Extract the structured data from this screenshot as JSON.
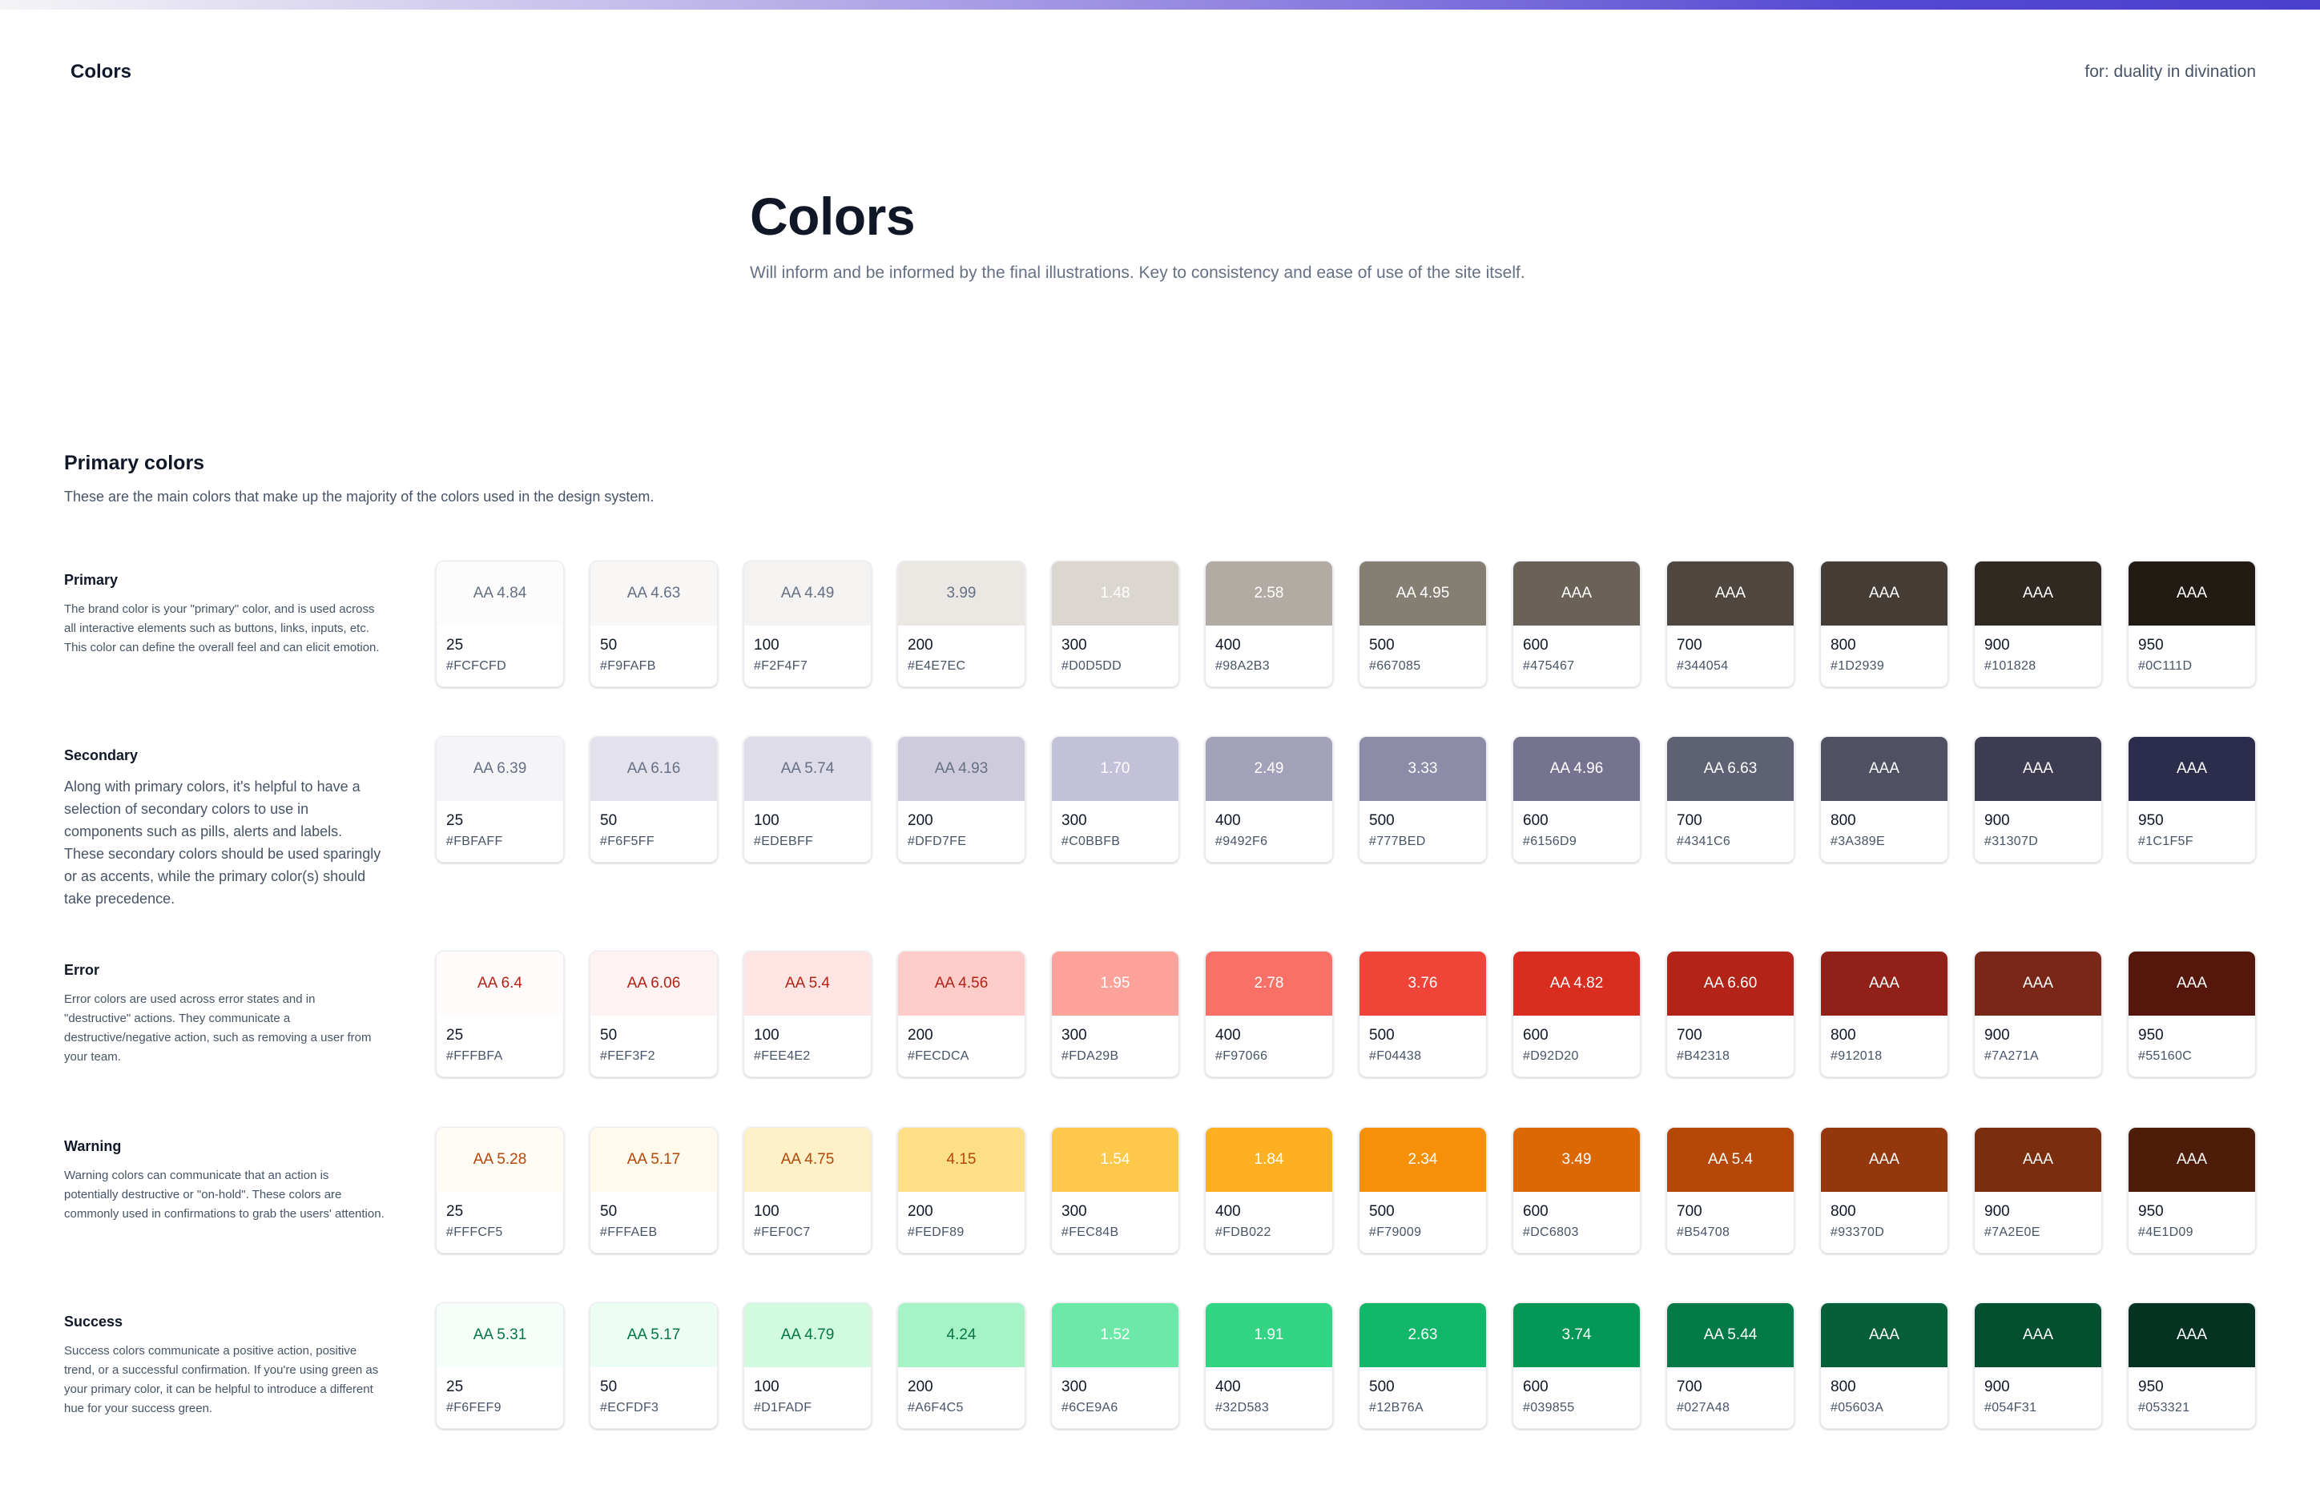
{
  "header": {
    "brand": "Colors",
    "for_label": "for: duality in divination"
  },
  "hero": {
    "title": "Colors",
    "subtitle": "Will inform and be informed by the final illustrations. Key to consistency and ease of use of the site itself."
  },
  "section": {
    "title": "Primary colors",
    "subtitle": "These are the main colors that make up the majority of the colors used in the design system."
  },
  "steps": [
    "25",
    "50",
    "100",
    "200",
    "300",
    "400",
    "500",
    "600",
    "700",
    "800",
    "900",
    "950"
  ],
  "groups": [
    {
      "name": "Primary",
      "description": "The brand color is your \"primary\" color, and is used across all interactive elements such as buttons, links, inputs, etc. This color can define the overall feel and can elicit emotion.",
      "text_colors": [
        "#667085",
        "#667085",
        "#667085",
        "#667085",
        "#ffffff",
        "#ffffff",
        "#ffffff",
        "#ffffff",
        "#ffffff",
        "#ffffff",
        "#ffffff",
        "#ffffff"
      ],
      "contrast": [
        "AA 4.84",
        "AA 4.63",
        "AA 4.49",
        "3.99",
        "1.48",
        "2.58",
        "AA 4.95",
        "AAA",
        "AAA",
        "AAA",
        "AAA",
        "AAA"
      ],
      "hex": [
        "#FCFCFD",
        "#F9FAFB",
        "#F2F4F7",
        "#E4E7EC",
        "#D0D5DD",
        "#98A2B3",
        "#667085",
        "#475467",
        "#344054",
        "#1D2939",
        "#101828",
        "#0C111D"
      ],
      "swatch_colors": [
        "#FCFCFD",
        "#F8F7F6",
        "#F5F3F1",
        "#EBE7E3",
        "#DCD6D1",
        "#B2ABA4",
        "#857E72",
        "#6A6159",
        "#4E463F",
        "#443C35",
        "#2F2922",
        "#221B14"
      ]
    },
    {
      "name": "Secondary",
      "description": "Along with primary colors, it's helpful to have a selection of secondary colors to use in components such as pills, alerts and labels. These secondary colors should be used sparingly or as accents, while the primary color(s) should take precedence.",
      "text_colors": [
        "#667085",
        "#667085",
        "#667085",
        "#667085",
        "#ffffff",
        "#ffffff",
        "#ffffff",
        "#ffffff",
        "#ffffff",
        "#ffffff",
        "#ffffff",
        "#ffffff"
      ],
      "contrast": [
        "AA 6.39",
        "AA 6.16",
        "AA 5.74",
        "AA 4.93",
        "1.70",
        "2.49",
        "3.33",
        "AA 4.96",
        "AA 6.63",
        "AAA",
        "AAA",
        "AAA"
      ],
      "hex": [
        "#FBFAFF",
        "#F6F5FF",
        "#EDEBFF",
        "#DFD7FE",
        "#C0BBFB",
        "#9492F6",
        "#777BED",
        "#6156D9",
        "#4341C6",
        "#3A389E",
        "#31307D",
        "#1C1F5F"
      ],
      "swatch_colors": [
        "#F5F5F7",
        "#E3E1EC",
        "#DEDCE8",
        "#CECBDC",
        "#C3C0DA",
        "#A3A1B9",
        "#8C8BA8",
        "#75738F",
        "#5E6174",
        "#4F5163",
        "#3D3C52",
        "#2C2C4C"
      ]
    },
    {
      "name": "Error",
      "description": "Error colors are used across error states and in \"destructive\" actions. They communicate a destructive/negative action, such as removing a user from your team.",
      "text_colors": [
        "#B42318",
        "#B42318",
        "#B42318",
        "#B42318",
        "#ffffff",
        "#ffffff",
        "#ffffff",
        "#ffffff",
        "#ffffff",
        "#ffffff",
        "#ffffff",
        "#ffffff"
      ],
      "contrast": [
        "AA 6.4",
        "AA 6.06",
        "AA 5.4",
        "AA 4.56",
        "1.95",
        "2.78",
        "3.76",
        "AA 4.82",
        "AA 6.60",
        "AAA",
        "AAA",
        "AAA"
      ],
      "hex": [
        "#FFFBFA",
        "#FEF3F2",
        "#FEE4E2",
        "#FECDCA",
        "#FDA29B",
        "#F97066",
        "#F04438",
        "#D92D20",
        "#B42318",
        "#912018",
        "#7A271A",
        "#55160C"
      ],
      "swatch_colors": [
        "#FFFBFA",
        "#FEF3F2",
        "#FEE4E2",
        "#FECDCA",
        "#FDA29B",
        "#F97066",
        "#F04438",
        "#D92D20",
        "#B42318",
        "#912018",
        "#7A271A",
        "#55160C"
      ]
    },
    {
      "name": "Warning",
      "description": "Warning colors can communicate that an action is potentially destructive or \"on-hold\". These colors are commonly used in confirmations to grab the users' attention.",
      "text_colors": [
        "#B54708",
        "#B54708",
        "#B54708",
        "#B54708",
        "#ffffff",
        "#ffffff",
        "#ffffff",
        "#ffffff",
        "#ffffff",
        "#ffffff",
        "#ffffff",
        "#ffffff"
      ],
      "contrast": [
        "AA 5.28",
        "AA 5.17",
        "AA 4.75",
        "4.15",
        "1.54",
        "1.84",
        "2.34",
        "3.49",
        "AA 5.4",
        "AAA",
        "AAA",
        "AAA"
      ],
      "hex": [
        "#FFFCF5",
        "#FFFAEB",
        "#FEF0C7",
        "#FEDF89",
        "#FEC84B",
        "#FDB022",
        "#F79009",
        "#DC6803",
        "#B54708",
        "#93370D",
        "#7A2E0E",
        "#4E1D09"
      ],
      "swatch_colors": [
        "#FFFCF5",
        "#FFFAEB",
        "#FEF0C7",
        "#FEDF89",
        "#FEC84B",
        "#FDB022",
        "#F79009",
        "#DC6803",
        "#B54708",
        "#93370D",
        "#7A2E0E",
        "#4E1D09"
      ]
    },
    {
      "name": "Success",
      "description": "Success colors communicate a positive action, positive trend, or a successful confirmation. If you're using green as your primary color, it can be helpful to introduce a different hue for your success green.",
      "text_colors": [
        "#067647",
        "#067647",
        "#067647",
        "#067647",
        "#ffffff",
        "#ffffff",
        "#ffffff",
        "#ffffff",
        "#ffffff",
        "#ffffff",
        "#ffffff",
        "#ffffff"
      ],
      "contrast": [
        "AA 5.31",
        "AA 5.17",
        "AA 4.79",
        "4.24",
        "1.52",
        "1.91",
        "2.63",
        "3.74",
        "AA 5.44",
        "AAA",
        "AAA",
        "AAA"
      ],
      "hex": [
        "#F6FEF9",
        "#ECFDF3",
        "#D1FADF",
        "#A6F4C5",
        "#6CE9A6",
        "#32D583",
        "#12B76A",
        "#039855",
        "#027A48",
        "#05603A",
        "#054F31",
        "#053321"
      ],
      "swatch_colors": [
        "#F6FEF9",
        "#ECFDF3",
        "#D1FADF",
        "#A6F4C5",
        "#6CE9A6",
        "#32D583",
        "#12B76A",
        "#039855",
        "#027A48",
        "#05603A",
        "#054F31",
        "#053321"
      ]
    }
  ]
}
